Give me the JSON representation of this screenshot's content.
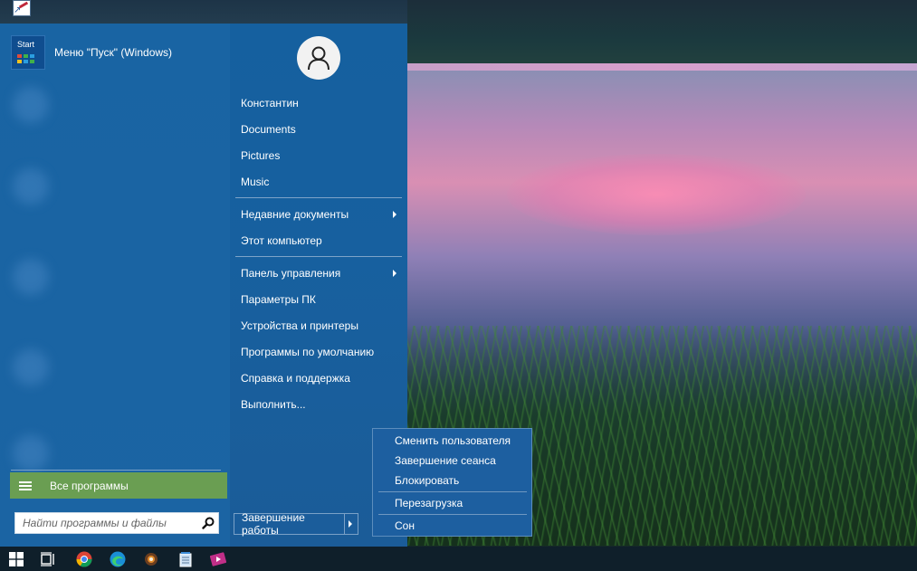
{
  "start_menu": {
    "pinned_app": {
      "label": "Меню \"Пуск\" (Windows)",
      "tile_text": "Start"
    },
    "all_programs_label": "Все программы",
    "search": {
      "placeholder": "Найти программы и файлы",
      "value": ""
    },
    "user_name": "Константин",
    "links": {
      "documents": "Documents",
      "pictures": "Pictures",
      "music": "Music",
      "recent_documents": "Недавние документы",
      "this_computer": "Этот компьютер",
      "control_panel": "Панель управления",
      "pc_settings": "Параметры ПК",
      "devices_printers": "Устройства и принтеры",
      "default_programs": "Программы по умолчанию",
      "help_support": "Справка и поддержка",
      "run": "Выполнить..."
    },
    "shutdown_label": "Завершение работы"
  },
  "power_menu": {
    "switch_user": "Сменить пользователя",
    "log_off": "Завершение сеанса",
    "lock": "Блокировать",
    "restart": "Перезагрузка",
    "sleep": "Сон"
  },
  "taskbar": {
    "icons": [
      "windows-start-icon",
      "task-view-icon",
      "chrome-icon",
      "edge-icon",
      "app-icon",
      "notepad-icon",
      "media-player-icon"
    ]
  },
  "colors": {
    "menu_blue": "#17609f",
    "all_programs_green": "#6a9e52",
    "taskbar": "#0f1f2a"
  }
}
